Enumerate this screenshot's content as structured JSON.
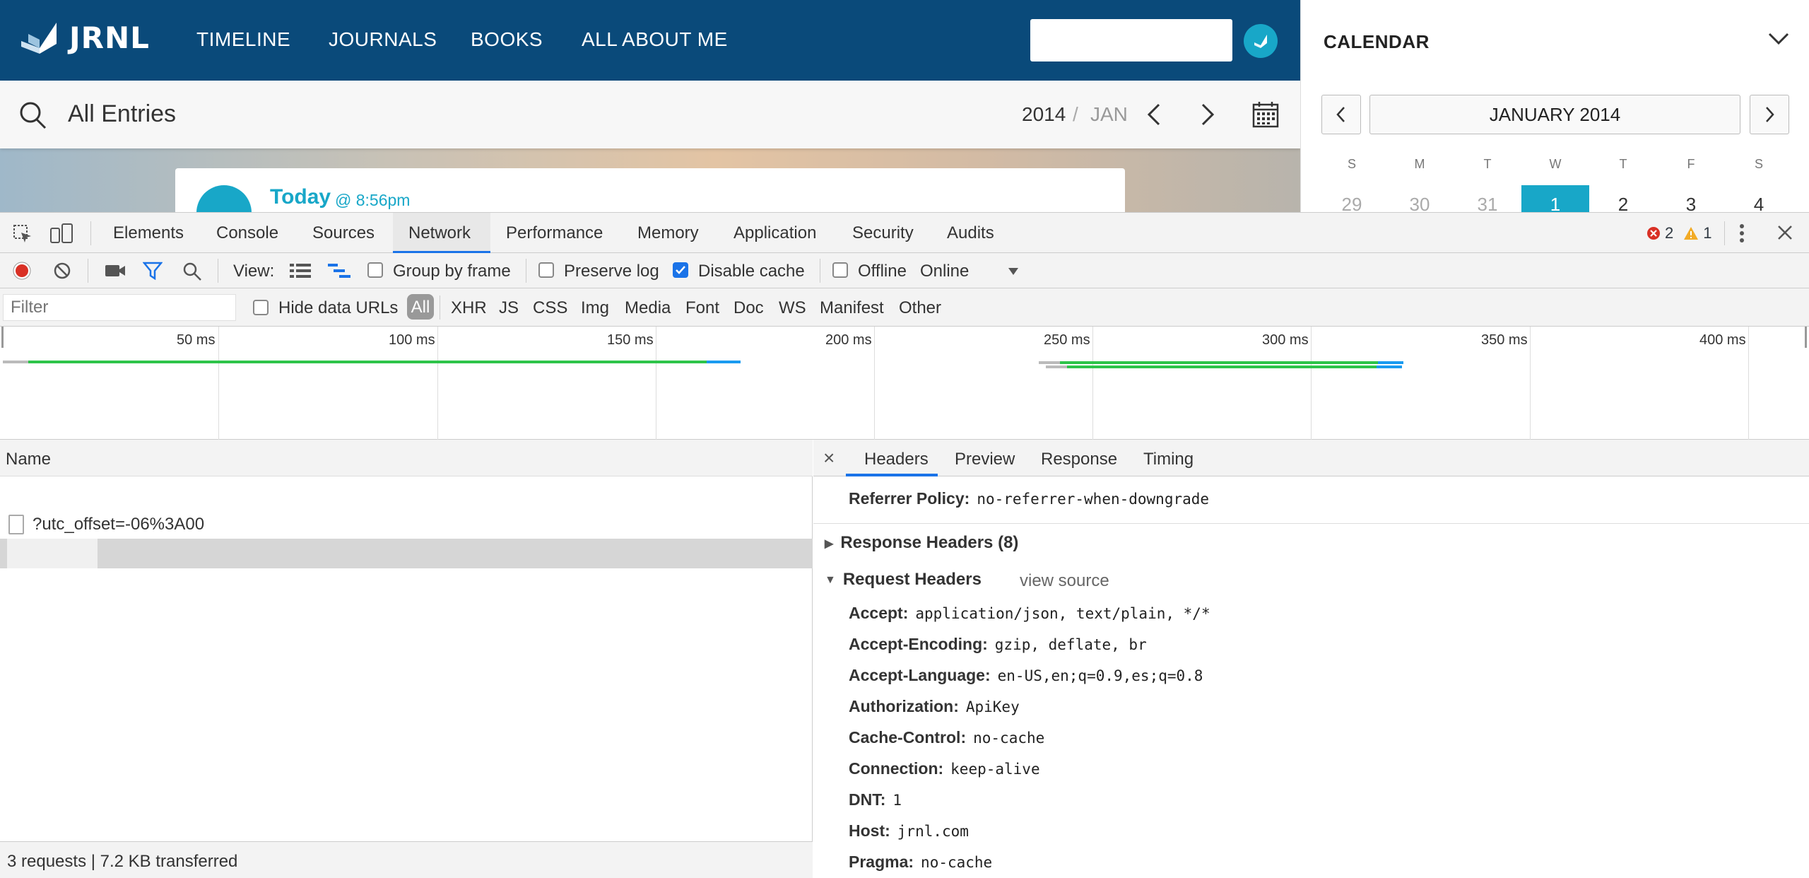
{
  "app": {
    "logo_text": "JRNL",
    "nav": [
      "TIMELINE",
      "JOURNALS",
      "BOOKS",
      "ALL ABOUT ME"
    ],
    "entries_title": "All Entries",
    "year": "2014",
    "slash": "/",
    "month": "JAN",
    "entry": {
      "day": "Today",
      "time": "@ 8:56pm"
    },
    "brand_color": "#0a4a7a",
    "accent_color": "#18a7c8"
  },
  "calendar": {
    "title": "CALENDAR",
    "month_label": "JANUARY 2014",
    "weekdays": [
      "S",
      "M",
      "T",
      "W",
      "T",
      "F",
      "S"
    ],
    "days": [
      "29",
      "30",
      "31",
      "1",
      "2",
      "3",
      "4"
    ],
    "selected_day": "1"
  },
  "devtools": {
    "tabs": [
      "Elements",
      "Console",
      "Sources",
      "Network",
      "Performance",
      "Memory",
      "Application",
      "Security",
      "Audits"
    ],
    "active_tab": "Network",
    "error_count": "2",
    "warning_count": "1",
    "toolbar": {
      "view_label": "View:",
      "group_by_frame": "Group by frame",
      "preserve_log": "Preserve log",
      "disable_cache": "Disable cache",
      "offline": "Offline",
      "throttle": "Online"
    },
    "filter": {
      "placeholder": "Filter",
      "hide_data_urls": "Hide data URLs",
      "types": [
        "All",
        "XHR",
        "JS",
        "CSS",
        "Img",
        "Media",
        "Font",
        "Doc",
        "WS",
        "Manifest",
        "Other"
      ]
    },
    "overview_ticks": [
      "50 ms",
      "100 ms",
      "150 ms",
      "200 ms",
      "250 ms",
      "300 ms",
      "350 ms",
      "400 ms"
    ],
    "requests": {
      "column_name": "Name",
      "rows": [
        "?utc_offset=-06%3A00"
      ],
      "summary": "3 requests | 7.2 KB transferred"
    },
    "details": {
      "close": "×",
      "tabs": [
        "Headers",
        "Preview",
        "Response",
        "Timing"
      ],
      "active_tab": "Headers",
      "referrer_policy": {
        "key": "Referrer Policy:",
        "value": "no-referrer-when-downgrade"
      },
      "response_headers_label": "Response Headers (8)",
      "request_headers_label": "Request Headers",
      "view_source": "view source",
      "request_headers": [
        {
          "key": "Accept:",
          "value": "application/json, text/plain, */*"
        },
        {
          "key": "Accept-Encoding:",
          "value": "gzip, deflate, br"
        },
        {
          "key": "Accept-Language:",
          "value": "en-US,en;q=0.9,es;q=0.8"
        },
        {
          "key": "Authorization:",
          "value": "ApiKey"
        },
        {
          "key": "Cache-Control:",
          "value": "no-cache"
        },
        {
          "key": "Connection:",
          "value": "keep-alive"
        },
        {
          "key": "DNT:",
          "value": "1"
        },
        {
          "key": "Host:",
          "value": "jrnl.com"
        },
        {
          "key": "Pragma:",
          "value": "no-cache"
        }
      ]
    }
  }
}
